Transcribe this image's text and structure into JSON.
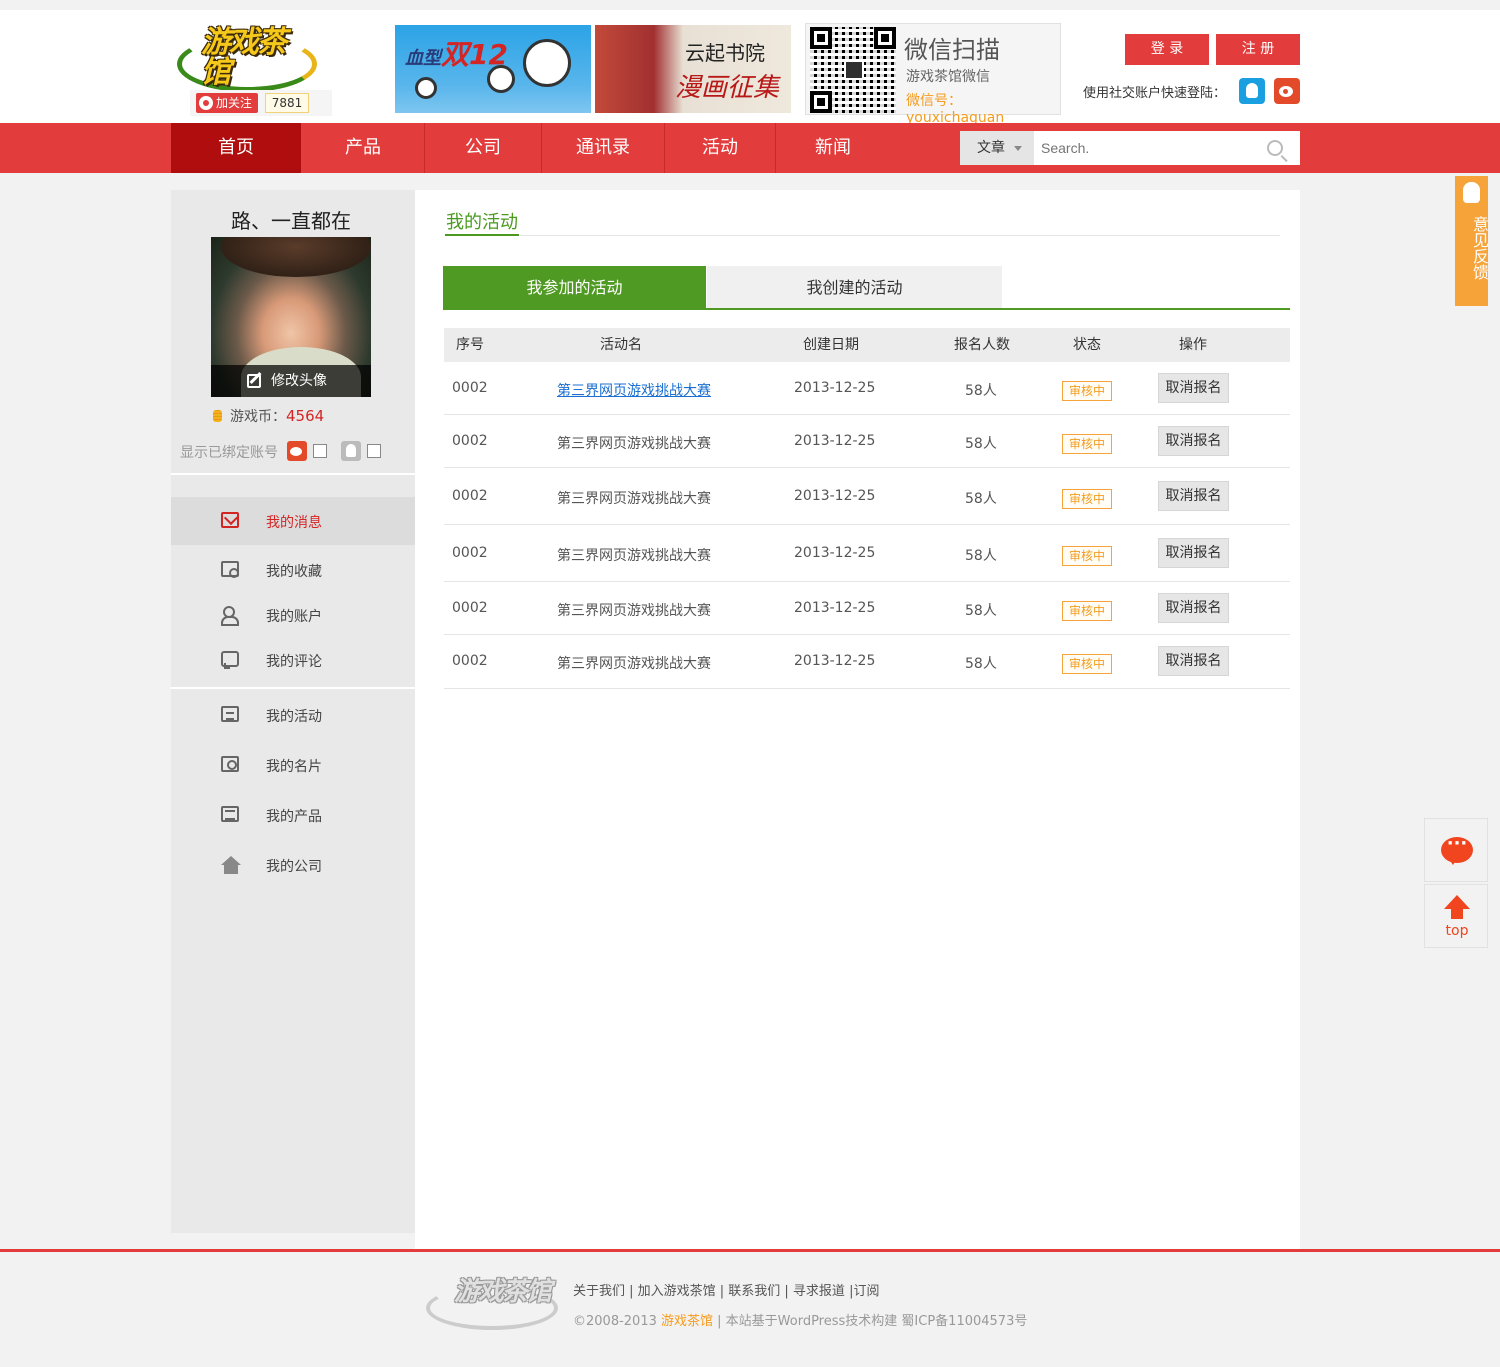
{
  "header": {
    "logo_text": "游戏茶馆",
    "follow_label": "加关注",
    "follow_count": "7881",
    "banner1": {
      "brand": "血型",
      "title": "双12"
    },
    "banner2": {
      "line1": "云起书院",
      "line2": "漫画征集"
    },
    "wechat": {
      "title": "微信扫描",
      "subtitle": "游戏茶馆微信",
      "account": "微信号：youxichaguan"
    },
    "login_label": "登 录",
    "register_label": "注 册",
    "social_label": "使用社交账户快速登陆："
  },
  "nav": {
    "items": [
      "首页",
      "产品",
      "公司",
      "通讯录",
      "活动",
      "新闻"
    ],
    "active_index": 0,
    "search_scope": "文章",
    "search_placeholder": "Search."
  },
  "sidebar": {
    "username": "路、一直都在",
    "edit_avatar": "修改头像",
    "coin_label": "游戏币：",
    "coin_value": "4564",
    "bind_label": "显示已绑定账号",
    "menu": [
      "我的消息",
      "我的收藏",
      "我的账户",
      "我的评论",
      "我的活动",
      "我的名片",
      "我的产品",
      "我的公司"
    ]
  },
  "main": {
    "title": "我的活动",
    "tabs": [
      "我参加的活动",
      "我创建的活动"
    ],
    "columns": [
      "序号",
      "活动名",
      "创建日期",
      "报名人数",
      "状态",
      "操作"
    ],
    "rows": [
      {
        "id": "0002",
        "name": "第三界网页游戏挑战大赛",
        "date": "2013-12-25",
        "count": "58人",
        "status": "审核中",
        "action": "取消报名"
      },
      {
        "id": "0002",
        "name": "第三界网页游戏挑战大赛",
        "date": "2013-12-25",
        "count": "58人",
        "status": "审核中",
        "action": "取消报名"
      },
      {
        "id": "0002",
        "name": "第三界网页游戏挑战大赛",
        "date": "2013-12-25",
        "count": "58人",
        "status": "审核中",
        "action": "取消报名"
      },
      {
        "id": "0002",
        "name": "第三界网页游戏挑战大赛",
        "date": "2013-12-25",
        "count": "58人",
        "status": "审核中",
        "action": "取消报名"
      },
      {
        "id": "0002",
        "name": "第三界网页游戏挑战大赛",
        "date": "2013-12-25",
        "count": "58人",
        "status": "审核中",
        "action": "取消报名"
      },
      {
        "id": "0002",
        "name": "第三界网页游戏挑战大赛",
        "date": "2013-12-25",
        "count": "58人",
        "status": "审核中",
        "action": "取消报名"
      }
    ]
  },
  "float": {
    "feedback_label": "意见反馈",
    "top_label": "top"
  },
  "footer": {
    "logo_text": "游戏茶馆",
    "links": "关于我们 | 加入游戏茶馆 | 联系我们 | 寻求报道 |订阅",
    "copyright_prefix": "©2008-2013 ",
    "copyright_brand": "游戏茶馆",
    "copyright_suffix": " | 本站基于WordPress技术构建   蜀ICP备11004573号"
  },
  "colors": {
    "brand_red": "#e23c3c",
    "nav_active": "#b00e0e",
    "accent_green": "#4f9a22",
    "status_orange": "#f59c1e",
    "link_blue": "#1a6fd0"
  }
}
